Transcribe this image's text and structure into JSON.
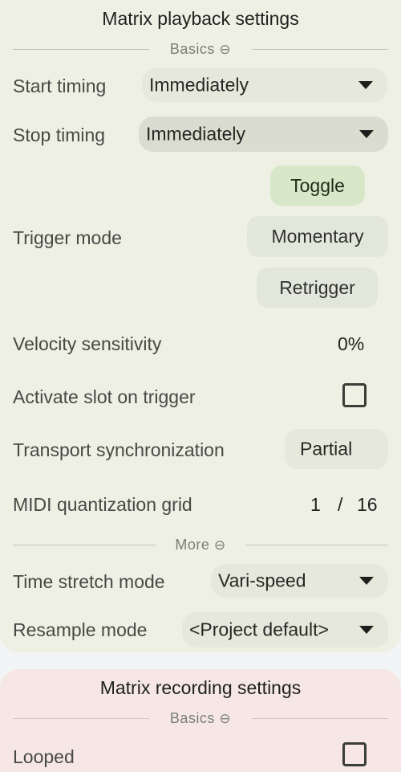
{
  "playback": {
    "title": "Matrix playback settings",
    "basics_label": "Basics",
    "basics_icon": "⊖",
    "start_timing": {
      "label": "Start timing",
      "value": "Immediately"
    },
    "stop_timing": {
      "label": "Stop timing",
      "value": "Immediately"
    },
    "trigger_mode": {
      "label": "Trigger mode",
      "options": [
        "Toggle",
        "Momentary",
        "Retrigger"
      ],
      "selected": "Toggle"
    },
    "velocity_sensitivity": {
      "label": "Velocity sensitivity",
      "value": "0%"
    },
    "activate_slot": {
      "label": "Activate slot on trigger",
      "checked": false
    },
    "transport_sync": {
      "label": "Transport synchronization",
      "value": "Partial"
    },
    "midi_grid": {
      "label": "MIDI quantization grid",
      "numerator": "1",
      "divider": "/",
      "denominator": "16"
    },
    "more_label": "More",
    "more_icon": "⊖",
    "time_stretch": {
      "label": "Time stretch mode",
      "value": "Vari-speed"
    },
    "resample": {
      "label": "Resample mode",
      "value": "<Project default>"
    }
  },
  "recording": {
    "title": "Matrix recording settings",
    "basics_label": "Basics",
    "basics_icon": "⊖",
    "looped": {
      "label": "Looped",
      "checked": false
    }
  }
}
